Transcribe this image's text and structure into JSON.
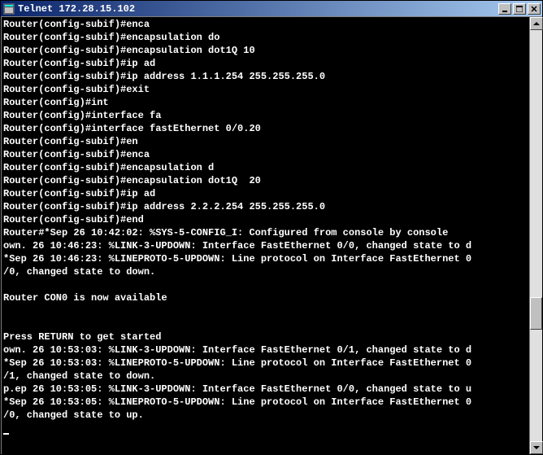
{
  "window": {
    "title": "Telnet 172.28.15.102"
  },
  "terminal": {
    "lines": [
      "Router(config-subif)#enca",
      "Router(config-subif)#encapsulation do",
      "Router(config-subif)#encapsulation dot1Q 10",
      "Router(config-subif)#ip ad",
      "Router(config-subif)#ip address 1.1.1.254 255.255.255.0",
      "Router(config-subif)#exit",
      "Router(config)#int",
      "Router(config)#interface fa",
      "Router(config)#interface fastEthernet 0/0.20",
      "Router(config-subif)#en",
      "Router(config-subif)#enca",
      "Router(config-subif)#encapsulation d",
      "Router(config-subif)#encapsulation dot1Q  20",
      "Router(config-subif)#ip ad",
      "Router(config-subif)#ip address 2.2.2.254 255.255.255.0",
      "Router(config-subif)#end",
      "Router#*Sep 26 10:42:02: %SYS-5-CONFIG_I: Configured from console by console",
      "own. 26 10:46:23: %LINK-3-UPDOWN: Interface FastEthernet 0/0, changed state to d",
      "*Sep 26 10:46:23: %LINEPROTO-5-UPDOWN: Line protocol on Interface FastEthernet 0",
      "/0, changed state to down.",
      "",
      "Router CON0 is now available",
      "",
      "",
      "Press RETURN to get started",
      "own. 26 10:53:03: %LINK-3-UPDOWN: Interface FastEthernet 0/1, changed state to d",
      "*Sep 26 10:53:03: %LINEPROTO-5-UPDOWN: Line protocol on Interface FastEthernet 0",
      "/1, changed state to down.",
      "p.ep 26 10:53:05: %LINK-3-UPDOWN: Interface FastEthernet 0/0, changed state to u",
      "*Sep 26 10:53:05: %LINEPROTO-5-UPDOWN: Line protocol on Interface FastEthernet 0",
      "/0, changed state to up."
    ]
  }
}
